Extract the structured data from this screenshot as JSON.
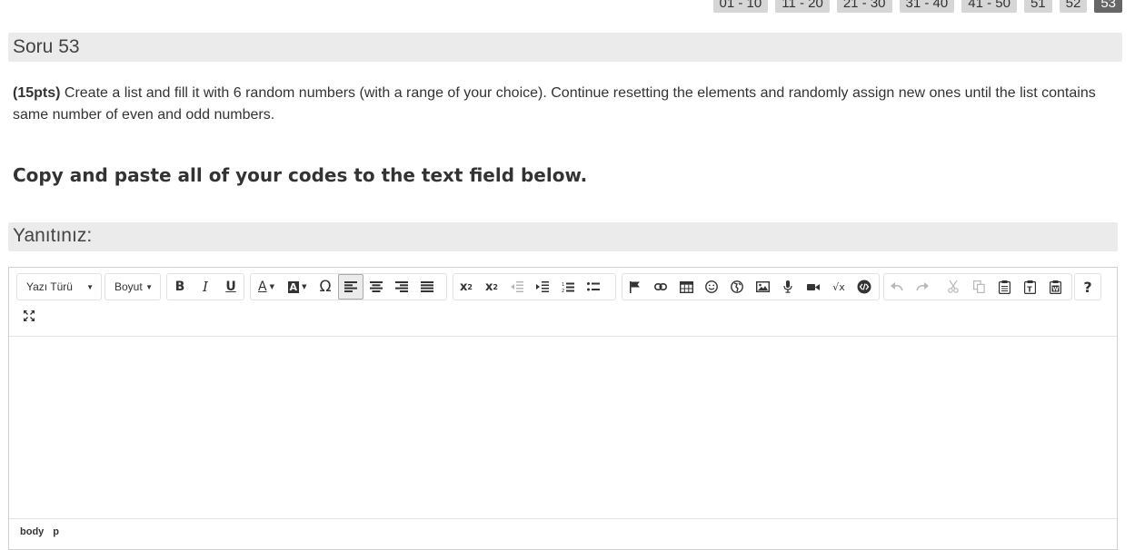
{
  "pagination": {
    "pages": [
      "01 - 10",
      "11 - 20",
      "21 - 30",
      "31 - 40",
      "41 - 50",
      "51",
      "52",
      "53"
    ],
    "active": "53"
  },
  "question": {
    "title": "Soru 53",
    "points": "(15pts)",
    "text": " Create a list and fill it with 6 random numbers (with a range of your choice). Continue resetting the elements and randomly assign new ones until the list contains same number of even and odd numbers.",
    "instruction": "Copy and paste all of your codes to the text field below."
  },
  "answer": {
    "label": "Yanıtınız:"
  },
  "editor": {
    "font_label": "Yazı Türü",
    "size_label": "Boyut",
    "path": [
      "body",
      "p"
    ]
  }
}
